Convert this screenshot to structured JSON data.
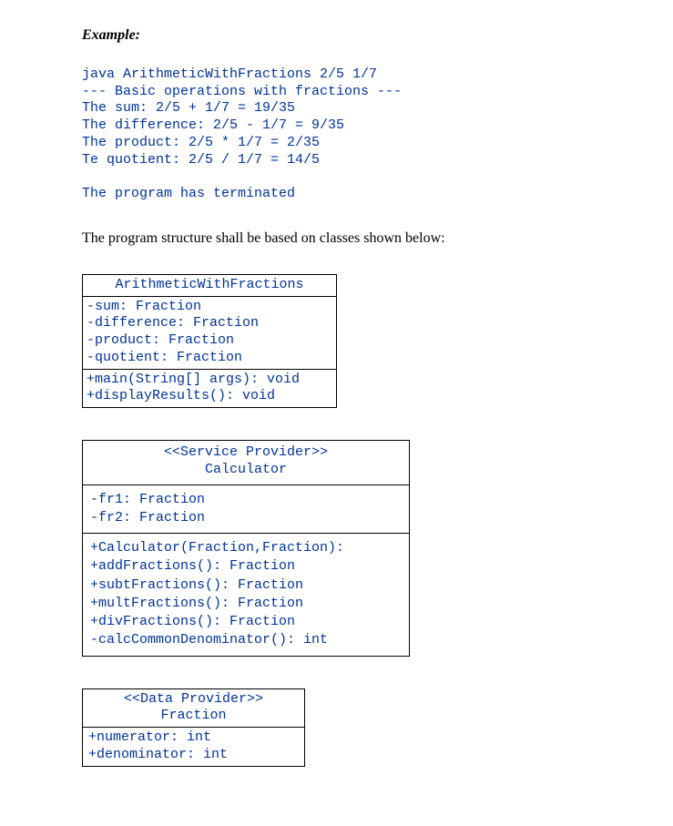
{
  "heading": "Example:",
  "codeLines": [
    "java ArithmeticWithFractions 2/5 1/7",
    "--- Basic operations with fractions ---",
    "The sum: 2/5 + 1/7 = 19/35",
    "The difference: 2/5 - 1/7 = 9/35",
    "The product: 2/5 * 1/7 = 2/35",
    "Te quotient: 2/5 / 1/7 = 14/5",
    "",
    "The program has terminated"
  ],
  "paragraph": "The program structure shall be based on classes shown below:",
  "uml1": {
    "headerLines": [
      "ArithmeticWithFractions"
    ],
    "attrs": [
      "-sum: Fraction",
      "-difference: Fraction",
      "-product: Fraction",
      "-quotient: Fraction"
    ],
    "methods": [
      "+main(String[] args): void",
      "+displayResults(): void"
    ]
  },
  "uml2": {
    "headerLines": [
      "<<Service Provider>>",
      "Calculator"
    ],
    "attrs": [
      "-fr1: Fraction",
      "-fr2: Fraction"
    ],
    "methods": [
      "+Calculator(Fraction,Fraction):",
      "+addFractions(): Fraction",
      "+subtFractions(): Fraction",
      "+multFractions(): Fraction",
      "+divFractions(): Fraction",
      "-calcCommonDenominator(): int"
    ]
  },
  "uml3": {
    "headerLines": [
      "<<Data Provider>>",
      "Fraction"
    ],
    "attrs": [
      "+numerator: int",
      "+denominator: int"
    ]
  }
}
